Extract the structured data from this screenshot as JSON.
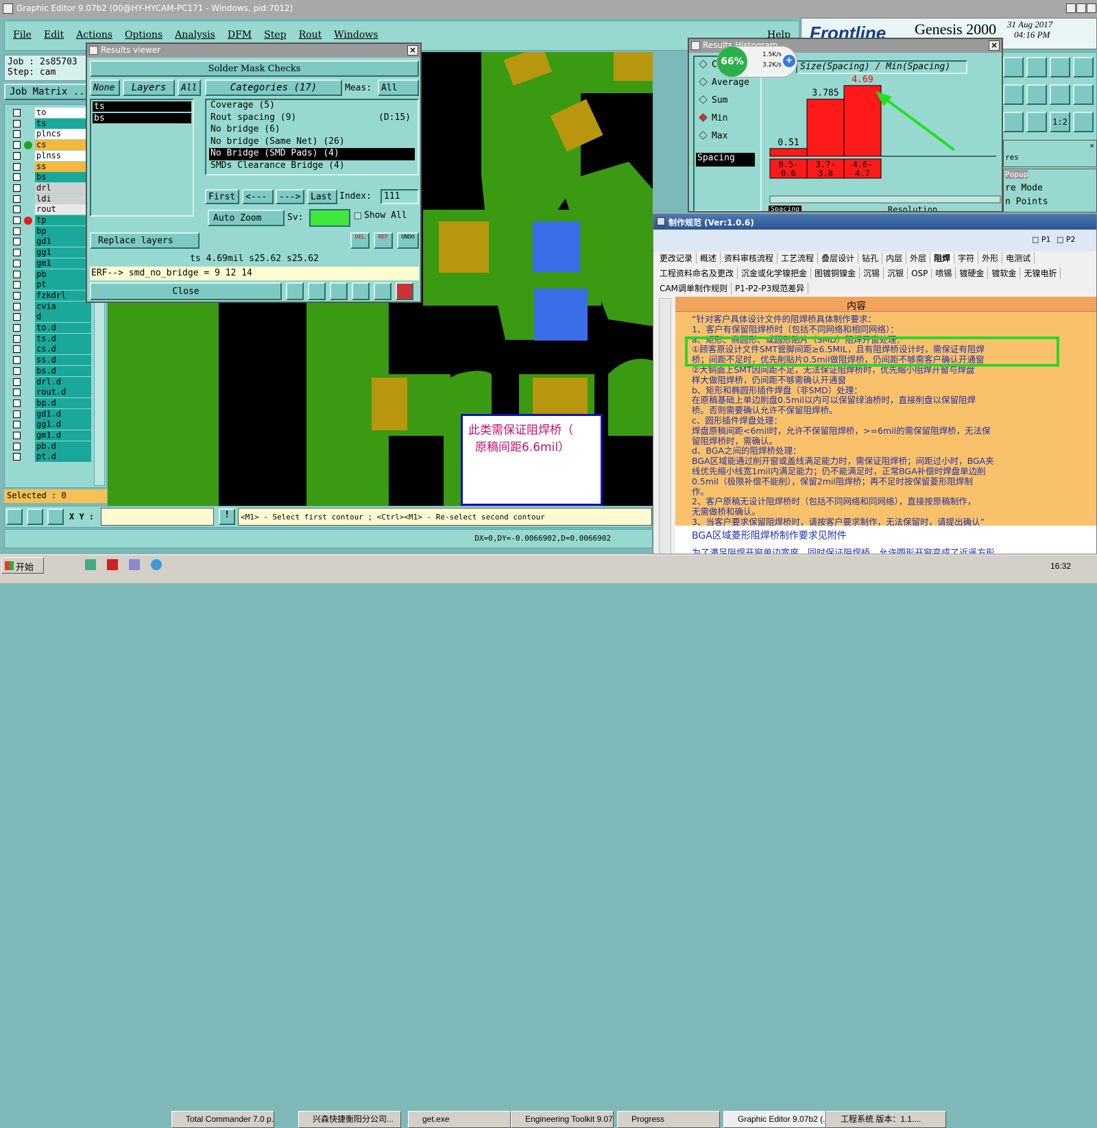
{
  "app": {
    "title": "Graphic Editor 9.07b2 (00@HY-HYCAM-PC171 - Windows, pid:7012)"
  },
  "menu": [
    "File",
    "Edit",
    "Actions",
    "Options",
    "Analysis",
    "DFM",
    "Step",
    "Rout",
    "Windows"
  ],
  "menu_help": "Help",
  "brand": {
    "logo": "Frontline",
    "product": "Genesis 2000",
    "date": "31 Aug 2017",
    "time": "04:16 PM"
  },
  "job": {
    "job": "Job : 2s85703",
    "step": "Step: cam",
    "matrix": "Job Matrix .."
  },
  "layers": [
    {
      "name": "to",
      "color": "#ffffff"
    },
    {
      "name": "ts",
      "color": "#1aa89a"
    },
    {
      "name": "plncs",
      "color": "#ffffff"
    },
    {
      "name": "cs",
      "color": "#f3b83d",
      "dot": "#22a022"
    },
    {
      "name": "plnss",
      "color": "#ffffff"
    },
    {
      "name": "ss",
      "color": "#f3b83d"
    },
    {
      "name": "bs",
      "color": "#1aa89a"
    },
    {
      "name": "drl",
      "color": "#d0d0d0"
    },
    {
      "name": "ldi",
      "color": "#d0d0d0"
    },
    {
      "name": "rout",
      "color": "#e8e8e8"
    },
    {
      "name": "tp",
      "color": "#1aa89a",
      "dot": "#e02020"
    },
    {
      "name": "bp",
      "color": "#1aa89a"
    },
    {
      "name": "gd1",
      "color": "#1aa89a"
    },
    {
      "name": "gg1",
      "color": "#1aa89a"
    },
    {
      "name": "gm1",
      "color": "#1aa89a"
    },
    {
      "name": "pb",
      "color": "#1aa89a"
    },
    {
      "name": "pt",
      "color": "#1aa89a"
    },
    {
      "name": "fzkdrl",
      "color": "#1aa89a"
    },
    {
      "name": "cvia",
      "color": "#1aa89a"
    },
    {
      "name": "d",
      "color": "#1aa89a"
    },
    {
      "name": "to.d",
      "color": "#1aa89a"
    },
    {
      "name": "ts.d",
      "color": "#1aa89a"
    },
    {
      "name": "cs.d",
      "color": "#1aa89a"
    },
    {
      "name": "ss.d",
      "color": "#1aa89a"
    },
    {
      "name": "bs.d",
      "color": "#1aa89a"
    },
    {
      "name": "drl.d",
      "color": "#1aa89a"
    },
    {
      "name": "rout.d",
      "color": "#1aa89a"
    },
    {
      "name": "bp.d",
      "color": "#1aa89a"
    },
    {
      "name": "gd1.d",
      "color": "#1aa89a"
    },
    {
      "name": "gg1.d",
      "color": "#1aa89a"
    },
    {
      "name": "gm1.d",
      "color": "#1aa89a"
    },
    {
      "name": "pb.d",
      "color": "#1aa89a"
    },
    {
      "name": "pt.d",
      "color": "#1aa89a"
    }
  ],
  "selected": "Selected : 0",
  "xy_label": "X Y :",
  "status_hint": "<M1> - Select first contour ; <Ctrl><M1> - Re-select second contour",
  "coords": "DX=0,DY=-0.0066902,D=0.0066902",
  "results": {
    "title": "Results viewer",
    "header": "Solder Mask Checks",
    "none": "None",
    "layers": "Layers",
    "all": "All",
    "layer_items": [
      "ts",
      "bs"
    ],
    "categories": "Categories (17)",
    "meas_label": "Meas:",
    "meas_value": "All",
    "items": [
      {
        "text": "Coverage (5)",
        "extra": ""
      },
      {
        "text": "Rout spacing (9)",
        "extra": "(D:15)"
      },
      {
        "text": "No bridge (6)",
        "extra": ""
      },
      {
        "text": "No bridge (Same Net) (26)",
        "extra": ""
      },
      {
        "text": "No Bridge (SMD Pads) (4)",
        "extra": "",
        "selected": true
      },
      {
        "text": "SMDs Clearance Bridge (4)",
        "extra": ""
      }
    ],
    "first": "First",
    "prev": "<---",
    "next": "--->",
    "last": "Last",
    "index_label": "Index:",
    "index_value": "111",
    "auto_zoom": "Auto Zoom",
    "sv_label": "Sv:",
    "show_all": "Show All",
    "replace": "Replace layers",
    "del": "DEL",
    "ref": "REF",
    "undo": "UNDO",
    "measure": "ts 4.69mil  s25.62  s25.62",
    "erf": "ERF--> smd_no_bridge = 9 12 14",
    "close": "Close"
  },
  "histogram": {
    "title": "Results Histogram",
    "options": [
      {
        "label": "Count",
        "selected": false
      },
      {
        "label": "Average",
        "selected": false
      },
      {
        "label": "Sum",
        "selected": false
      },
      {
        "label": "Min",
        "selected": true
      },
      {
        "label": "Max",
        "selected": false
      }
    ],
    "spacing": "Spacing",
    "heading": "Size(Spacing) / Min(Spacing)",
    "bars": [
      {
        "value": 0.51,
        "label": "0.51",
        "range": "0.5-0.6"
      },
      {
        "value": 3.785,
        "label": "3.785",
        "range": "3.7-3.8"
      },
      {
        "value": 4.69,
        "label": "4.69",
        "range": "4.6-4.7"
      }
    ],
    "ymax": 5,
    "bottom_left": "Spacing",
    "resolution": "Resolution"
  },
  "netmon": {
    "percent": "66%",
    "up": "1.5K/s",
    "down": "3.2K/s"
  },
  "right_panels": {
    "res": "res",
    "popup": "Popup",
    "mode": "re Mode",
    "points": "n Points"
  },
  "canvas_note": {
    "line1": "此类需保证阻焊桥（",
    "line2": "原稿间距6.6mil）"
  },
  "spec": {
    "title": "制作规范 (Ver:1.0.6)",
    "p1": "P1",
    "p2": "P2",
    "tabs1": [
      "更改记录",
      "概述",
      "资料审核流程",
      "工艺流程",
      "叠层设计",
      "钻孔",
      "内层",
      "外层",
      "阻焊",
      "字符",
      "外形",
      "电测试"
    ],
    "tabs2": [
      "工程资料命名及更改",
      "沉金或化学镍把金",
      "图镀铜镍金",
      "沉锡",
      "沉银",
      "OSP",
      "喷锡",
      "镀硬金",
      "镀软金",
      "无镍电折"
    ],
    "tabs3": [
      "CAM调单制作规则",
      "P1-P2-P3规范差异"
    ],
    "col_header": "内容",
    "lines": [
      "“针对客户具体设计文件的阻焊桥具体制作要求：",
      "1、客户有保留阻焊桥时（包括不同网络和相同网络）：",
      "a、矩形、椭圆形、或圆形贴片（SMD）阻焊开窗处理：",
      "①顾客原设计文件SMT管脚间距≥6.5MIL，且有阻焊桥设计时，需保证有阻焊",
      "桥；间距不足时，优先削贴片0.5mil做阻焊桥，仍间距不够需客户确认开通窗",
      "②大铜面上SMT因间距不足，无法保证阻焊桥时，优先缩小阻焊开窗与焊盘",
      "样大做阻焊桥，仍间距不够需确认开通窗",
      "b、矩形和椭圆形插件焊盘（非SMD）处理：",
      "在原稿基础上单边削盘0.5mil以内可以保留绿油桥时，直接削盘以保留阻焊",
      "桥。否则需要确认允许不保留阻焊桥。",
      "c、圆形插件焊盘处理：",
      "焊盘原稿间距<6mil时，允许不保留阻焊桥，>=6mil的需保留阻焊桥，无法保",
      "留阻焊桥时，需确认。",
      "d、BGA之间的阻焊桥处理：",
      "BGA区域能通过削开窗或盖线满足能力时，需保证阻焊桥；间距过小时，BGA夹",
      "线优先缩小线宽1mil内满足能力；仍不能满足时，正常BGA补偿时焊盘单边削",
      "0.5mil（极限补偿不能削），保留2mil阻焊桥；再不足时按保留菱形阻焊制",
      "作。",
      "2、客户原稿无设计阻焊桥时（包括不同网络和同网络），直接按原稿制作，",
      "无需做桥和确认。",
      "3、当客户要求保留阻焊桥时，请按客户要求制作，无法保留时，请提出确认”"
    ],
    "row2": "BGA区域菱形阻焊桥制作要求见附件",
    "row3": "为了满足阻焊开窗单边宽度，同时保证阻焊桥，允许圆形开窗变成了近遥方形"
  },
  "taskbar": {
    "start": "开始",
    "items": [
      "Total Commander 7.0 p...",
      "兴森快捷衡阳分公司...",
      "get.exe",
      "Engineering Toolkit 9.07...",
      "Progress",
      "Graphic Editor 9.07b2 (...",
      "工程系统  版本：1.1...."
    ],
    "clock": "16:32"
  }
}
